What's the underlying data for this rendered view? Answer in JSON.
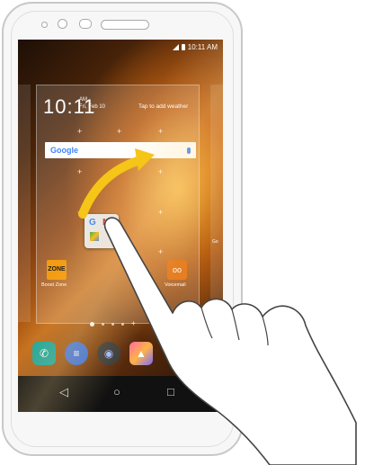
{
  "status_bar": {
    "time": "10:11 AM"
  },
  "clock_widget": {
    "time": "10:11",
    "ampm": "AM",
    "date": "Fri, Feb 10",
    "tap_weather": "Tap to add weather"
  },
  "search_bar": {
    "label": "Google"
  },
  "folder": {
    "label": "GM"
  },
  "apps": {
    "boost_zone": {
      "icon_text": "ZONE",
      "label": "Boost Zone"
    },
    "voicemail": {
      "icon_text": "oo",
      "label": "Voicemail"
    },
    "ghost_label": "Go"
  },
  "page_indicator": {
    "pages": 4,
    "active": 0
  },
  "dock": [
    "Phone",
    "Messages",
    "Camera",
    "Gallery"
  ],
  "colors": {
    "arrow": "#f5c518",
    "search_mic": "#4285f4",
    "dock_phone": "#17a39b",
    "dock_messages": "#3b6fd8"
  },
  "icons": {
    "back": "triangle-left",
    "home": "circle",
    "recents": "square"
  }
}
